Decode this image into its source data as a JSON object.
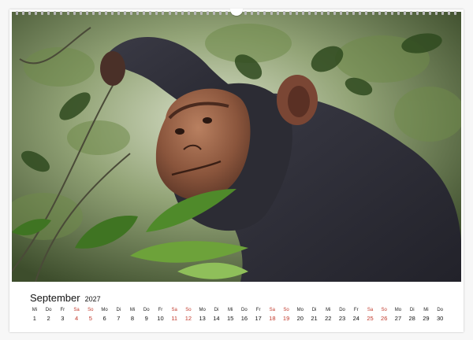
{
  "calendar": {
    "month": "September",
    "year": "2027",
    "days": [
      {
        "wd": "Mi",
        "d": "1",
        "weekend": false
      },
      {
        "wd": "Do",
        "d": "2",
        "weekend": false
      },
      {
        "wd": "Fr",
        "d": "3",
        "weekend": false
      },
      {
        "wd": "Sa",
        "d": "4",
        "weekend": true
      },
      {
        "wd": "So",
        "d": "5",
        "weekend": true
      },
      {
        "wd": "Mo",
        "d": "6",
        "weekend": false
      },
      {
        "wd": "Di",
        "d": "7",
        "weekend": false
      },
      {
        "wd": "Mi",
        "d": "8",
        "weekend": false
      },
      {
        "wd": "Do",
        "d": "9",
        "weekend": false
      },
      {
        "wd": "Fr",
        "d": "10",
        "weekend": false
      },
      {
        "wd": "Sa",
        "d": "11",
        "weekend": true
      },
      {
        "wd": "So",
        "d": "12",
        "weekend": true
      },
      {
        "wd": "Mo",
        "d": "13",
        "weekend": false
      },
      {
        "wd": "Di",
        "d": "14",
        "weekend": false
      },
      {
        "wd": "Mi",
        "d": "15",
        "weekend": false
      },
      {
        "wd": "Do",
        "d": "16",
        "weekend": false
      },
      {
        "wd": "Fr",
        "d": "17",
        "weekend": false
      },
      {
        "wd": "Sa",
        "d": "18",
        "weekend": true
      },
      {
        "wd": "So",
        "d": "19",
        "weekend": true
      },
      {
        "wd": "Mo",
        "d": "20",
        "weekend": false
      },
      {
        "wd": "Di",
        "d": "21",
        "weekend": false
      },
      {
        "wd": "Mi",
        "d": "22",
        "weekend": false
      },
      {
        "wd": "Do",
        "d": "23",
        "weekend": false
      },
      {
        "wd": "Fr",
        "d": "24",
        "weekend": false
      },
      {
        "wd": "Sa",
        "d": "25",
        "weekend": true
      },
      {
        "wd": "So",
        "d": "26",
        "weekend": true
      },
      {
        "wd": "Mo",
        "d": "27",
        "weekend": false
      },
      {
        "wd": "Di",
        "d": "28",
        "weekend": false
      },
      {
        "wd": "Mi",
        "d": "29",
        "weekend": false
      },
      {
        "wd": "Do",
        "d": "30",
        "weekend": false
      }
    ]
  },
  "colors": {
    "weekend": "#c0392b",
    "text": "#111111"
  }
}
